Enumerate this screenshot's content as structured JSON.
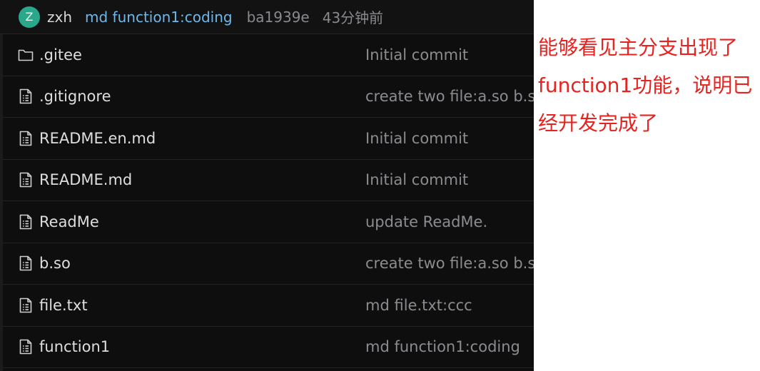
{
  "commit_bar": {
    "avatar_letter": "Z",
    "author": "zxh",
    "message": "md function1:coding",
    "hash": "ba1939e",
    "time": "43分钟前"
  },
  "files": [
    {
      "name": ".gitee",
      "type": "folder",
      "message": "Initial commit"
    },
    {
      "name": ".gitignore",
      "type": "file",
      "message": "create two file:a.so b.so"
    },
    {
      "name": "README.en.md",
      "type": "file",
      "message": "Initial commit"
    },
    {
      "name": "README.md",
      "type": "file",
      "message": "Initial commit"
    },
    {
      "name": "ReadMe",
      "type": "file",
      "message": "update ReadMe."
    },
    {
      "name": "b.so",
      "type": "file",
      "message": "create two file:a.so b.so"
    },
    {
      "name": "file.txt",
      "type": "file",
      "message": "md file.txt:ccc"
    },
    {
      "name": "function1",
      "type": "file",
      "message": "md function1:coding"
    }
  ],
  "annotation": {
    "lines": [
      "能够看见主分支出现了",
      "function1功能，说明已",
      "经开发完成了"
    ],
    "color": "#e8231f"
  },
  "colors": {
    "background": "#0e0e0f",
    "accent_link": "#6fb8ea",
    "avatar": "#2aa88b"
  }
}
